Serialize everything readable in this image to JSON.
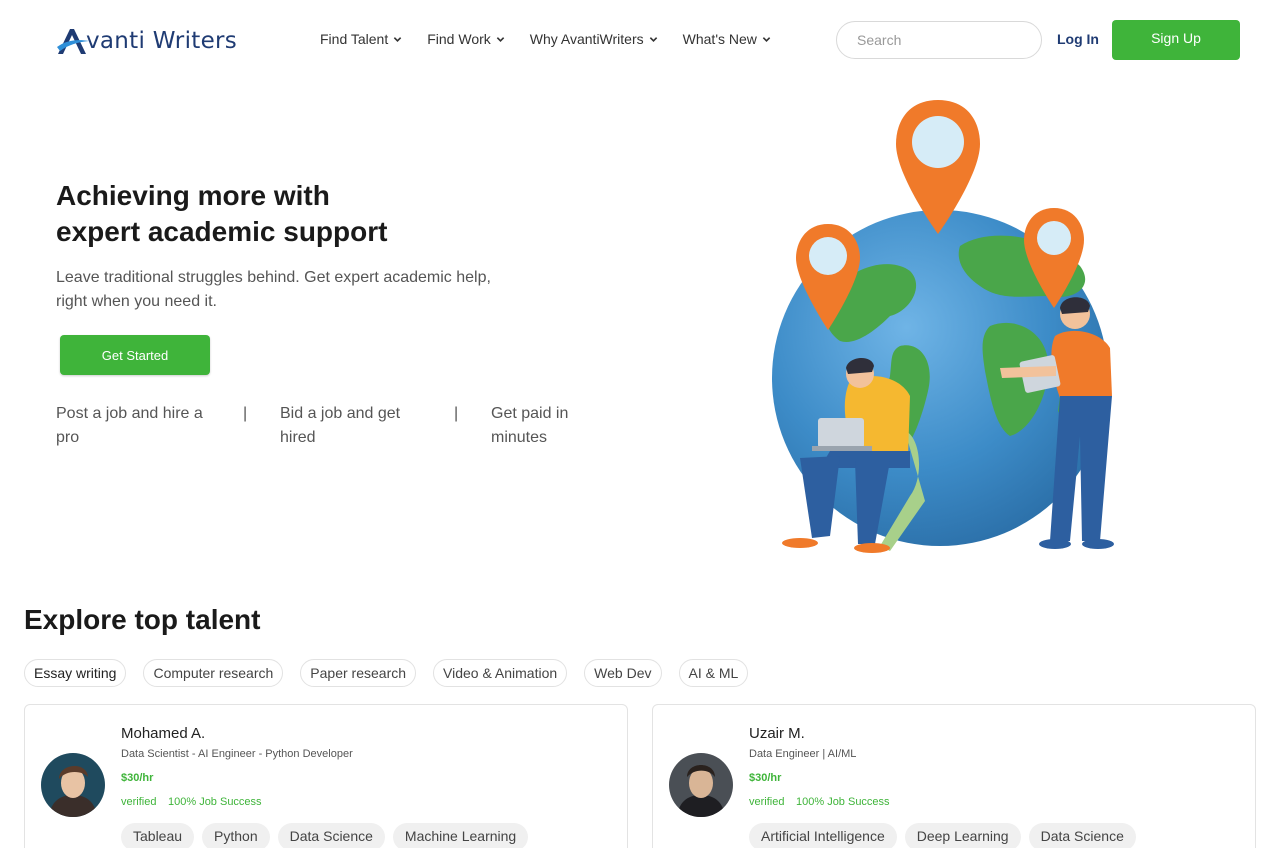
{
  "brand": {
    "name": "vanti Writers",
    "primary": "#1f3b73",
    "accent": "#3fb43a"
  },
  "nav": {
    "items": [
      {
        "label": "Find Talent",
        "icon": "chevron-down-icon"
      },
      {
        "label": "Find Work",
        "icon": "chevron-down-icon"
      },
      {
        "label": "Why AvantiWriters",
        "icon": "chevron-down-icon"
      },
      {
        "label": "What's New",
        "icon": "chevron-down-icon"
      }
    ],
    "search_placeholder": "Search",
    "login_label": "Log In",
    "signup_label": "Sign Up"
  },
  "hero": {
    "title_line1": "Achieving more with",
    "title_line2": "expert academic support",
    "subtitle": "Leave traditional struggles behind. Get expert academic help, right when you need it.",
    "cta_label": "Get Started",
    "steps": [
      "Post a job and hire a pro",
      "Bid a job and get hired",
      "Get paid in minutes"
    ],
    "separator": "|"
  },
  "explore": {
    "title": "Explore top talent",
    "categories": [
      "Essay writing",
      "Computer research",
      "Paper research",
      "Video & Animation",
      "Web Dev",
      "AI & ML"
    ]
  },
  "talents": [
    {
      "name": "Mohamed A.",
      "title": "Data Scientist - AI Engineer - Python Developer",
      "rate": "$30/hr",
      "verified": "verified",
      "success": "100% Job Success",
      "skills": [
        "Tableau",
        "Python",
        "Data Science",
        "Machine Learning"
      ]
    },
    {
      "name": "Uzair M.",
      "title": "Data Engineer | AI/ML",
      "rate": "$30/hr",
      "verified": "verified",
      "success": "100% Job Success",
      "skills": [
        "Artificial Intelligence",
        "Deep Learning",
        "Data Science"
      ]
    }
  ]
}
